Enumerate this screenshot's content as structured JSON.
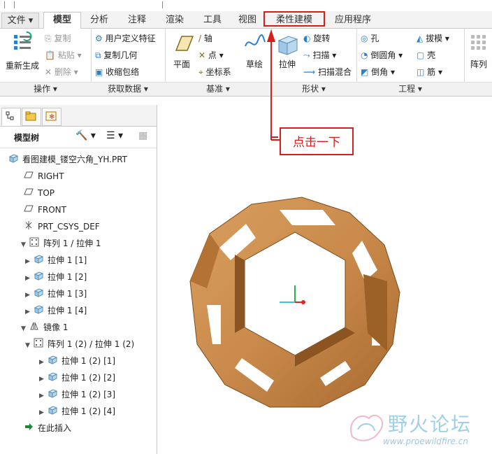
{
  "tabs": [
    {
      "label": "文件",
      "has_dropdown": true
    },
    {
      "label": "模型",
      "active": true
    },
    {
      "label": "分析"
    },
    {
      "label": "注释"
    },
    {
      "label": "渲染"
    },
    {
      "label": "工具"
    },
    {
      "label": "视图"
    },
    {
      "label": "柔性建模",
      "highlighted": true
    },
    {
      "label": "应用程序"
    }
  ],
  "ribbon": {
    "operations": {
      "regenerate": "重新生成",
      "copy": "复制",
      "paste": "粘贴",
      "delete": "删除",
      "group": "操作"
    },
    "get_data": {
      "udf": "用户定义特征",
      "copy_geom": "复制几何",
      "shrinkwrap": "收缩包络",
      "group": "获取数据"
    },
    "datum": {
      "plane": "平面",
      "axis": "轴",
      "point": "点",
      "csys": "坐标系",
      "sketch": "草绘",
      "group": "基准"
    },
    "shapes": {
      "extrude": "拉伸",
      "revolve": "旋转",
      "sweep": "扫描",
      "swept_blend": "扫描混合",
      "group": "形状"
    },
    "engineering": {
      "hole": "孔",
      "round": "倒圆角",
      "chamfer": "倒角",
      "draft": "拔模",
      "shell": "壳",
      "rib": "筋",
      "group": "工程"
    },
    "pattern": "阵列"
  },
  "model_tree": {
    "header": "模型树",
    "items": [
      {
        "label": "看图建模_镂空六角_YH.PRT",
        "icon": "part-icon",
        "level": 0,
        "arrow": ""
      },
      {
        "label": "RIGHT",
        "icon": "datum-plane-icon",
        "level": 1,
        "arrow": ""
      },
      {
        "label": "TOP",
        "icon": "datum-plane-icon",
        "level": 1,
        "arrow": ""
      },
      {
        "label": "FRONT",
        "icon": "datum-plane-icon",
        "level": 1,
        "arrow": ""
      },
      {
        "label": "PRT_CSYS_DEF",
        "icon": "csys-icon",
        "level": 1,
        "arrow": ""
      },
      {
        "label": "阵列 1 / 拉伸 1",
        "icon": "pattern-icon",
        "level": 1,
        "arrow": "▼"
      },
      {
        "label": "拉伸 1 [1]",
        "icon": "extrude-icon",
        "level": 2,
        "arrow": "▶"
      },
      {
        "label": "拉伸 1 [2]",
        "icon": "extrude-icon",
        "level": 2,
        "arrow": "▶"
      },
      {
        "label": "拉伸 1 [3]",
        "icon": "extrude-icon",
        "level": 2,
        "arrow": "▶"
      },
      {
        "label": "拉伸 1 [4]",
        "icon": "extrude-icon",
        "level": 2,
        "arrow": "▶"
      },
      {
        "label": "镜像 1",
        "icon": "mirror-icon",
        "level": 1,
        "arrow": "▼"
      },
      {
        "label": "阵列 1 (2) / 拉伸 1 (2)",
        "icon": "pattern-icon",
        "level": 2,
        "arrow": "▼"
      },
      {
        "label": "拉伸 1 (2) [1]",
        "icon": "extrude-icon",
        "level": 3,
        "arrow": "▶"
      },
      {
        "label": "拉伸 1 (2) [2]",
        "icon": "extrude-icon",
        "level": 3,
        "arrow": "▶"
      },
      {
        "label": "拉伸 1 (2) [3]",
        "icon": "extrude-icon",
        "level": 3,
        "arrow": "▶"
      },
      {
        "label": "拉伸 1 (2) [4]",
        "icon": "extrude-icon",
        "level": 3,
        "arrow": "▶"
      },
      {
        "label": "在此插入",
        "icon": "insert-here-icon",
        "level": 1,
        "arrow": ""
      }
    ]
  },
  "callout": {
    "text": "点击一下"
  },
  "watermark": {
    "site_cn": "野火论坛",
    "url": "www.proewildfire.cn"
  },
  "colors": {
    "accent_red": "#d91c1c",
    "wood": "#c98a4b"
  }
}
